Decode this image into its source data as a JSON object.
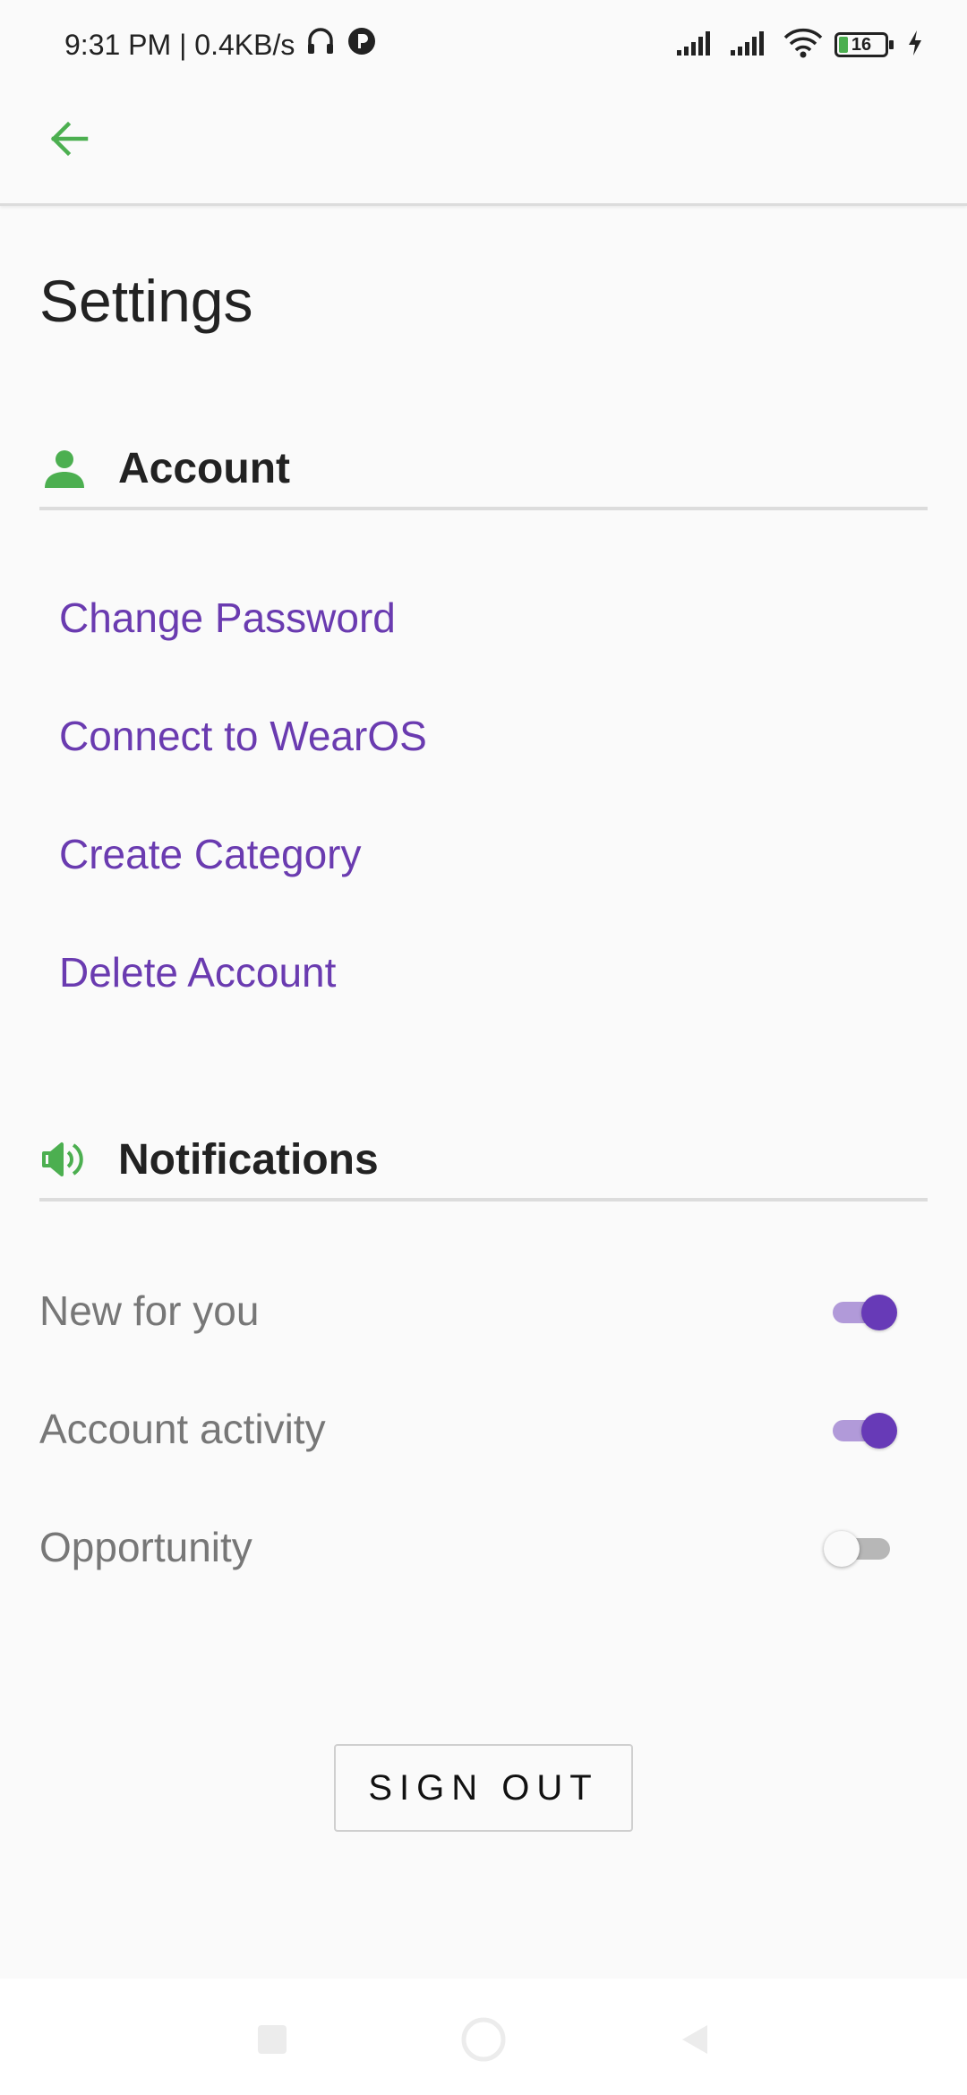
{
  "status_bar": {
    "time_speed": "9:31 PM | 0.4KB/s",
    "battery_level": "16",
    "icons": [
      "headphones-icon",
      "app-notification-icon",
      "signal-icon",
      "signal-icon",
      "wifi-icon",
      "battery-icon",
      "charging-icon"
    ]
  },
  "app_bar": {
    "back_icon": "arrow-left-icon"
  },
  "page": {
    "title": "Settings"
  },
  "account": {
    "header": "Account",
    "icon": "person-icon",
    "links": [
      {
        "label": "Change Password"
      },
      {
        "label": "Connect to WearOS"
      },
      {
        "label": "Create Category"
      },
      {
        "label": "Delete Account"
      }
    ]
  },
  "notifications": {
    "header": "Notifications",
    "icon": "speaker-icon",
    "items": [
      {
        "label": "New for you",
        "enabled": true
      },
      {
        "label": "Account activity",
        "enabled": true
      },
      {
        "label": "Opportunity",
        "enabled": false
      }
    ]
  },
  "signout": {
    "label": "SIGN OUT"
  },
  "colors": {
    "accent_green": "#4caf50",
    "link_purple": "#6a3bb0",
    "toggle_on": "#673ab7"
  }
}
